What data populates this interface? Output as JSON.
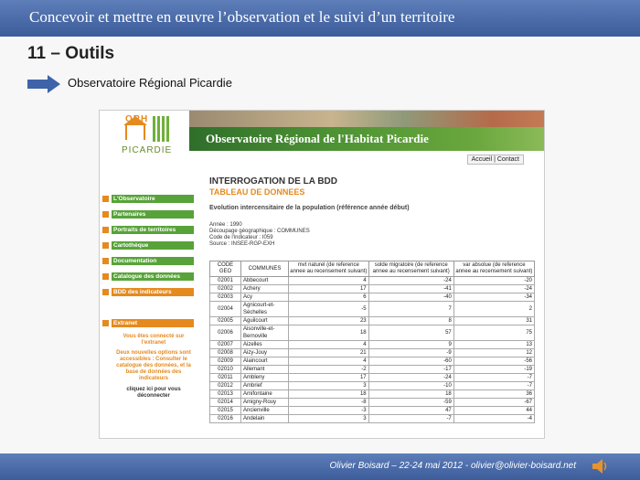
{
  "slide": {
    "title": "Concevoir et mettre en œuvre l’observation et le suivi d’un territoire",
    "heading": "11 – Outils",
    "subtitle": "Observatoire Régional Picardie",
    "footer": "Olivier Boisard – 22-24 mai 2012 - olivier@olivier-boisard.net"
  },
  "site": {
    "logo_top": "ORH",
    "logo_bottom": "PICARDIE",
    "banner": "Observatoire Régional de l'Habitat Picardie",
    "header_link": "Accueil | Contact",
    "nav": [
      {
        "label": "L'Observatoire",
        "color": "green"
      },
      {
        "label": "Partenaires",
        "color": "green"
      },
      {
        "label": "Portraits de territoires",
        "color": "green"
      },
      {
        "label": "Cartothèque",
        "color": "green"
      },
      {
        "label": "Documentation",
        "color": "green"
      },
      {
        "label": "Catalogue des données",
        "color": "green"
      },
      {
        "label": "BDD des indicateurs",
        "color": "orange"
      },
      {
        "label": "Extranet",
        "color": "orange"
      }
    ],
    "extranet_text1": "Vous êtes connecté sur l'extranet",
    "extranet_text2": "Deux nouvelles options sont accessibles : Consulter le catalogue des données, et la base de données des indicateurs",
    "extranet_text3": "cliquez ici pour vous déconnecter"
  },
  "main": {
    "title": "INTERROGATION DE LA BDD",
    "subtitle": "TABLEAU DE DONNEES",
    "section": "Evolution intercensitaire de la population (référence année début)",
    "meta": [
      "Année : 1990",
      "Découpage géographique : COMMUNES",
      "Code de l'indicateur : I059",
      "Source : INSEE-RGP-EXH"
    ],
    "columns": [
      "CODE GEO",
      "COMMUNES",
      "mvt naturel (de reference annee au recensement suivant)",
      "solde migratoire (de reference annee au recensement suivant)",
      "var absolue (de reference annee au recensement suivant)"
    ],
    "rows": [
      [
        "02001",
        "Abbecourt",
        "4",
        "-24",
        "-20"
      ],
      [
        "02002",
        "Achery",
        "17",
        "-41",
        "-24"
      ],
      [
        "02003",
        "Acy",
        "6",
        "-40",
        "-34"
      ],
      [
        "02004",
        "Agnicourt-et-Séchelles",
        "-5",
        "7",
        "2"
      ],
      [
        "02005",
        "Aguilcourt",
        "23",
        "8",
        "31"
      ],
      [
        "02006",
        "Aisonville-et-Bernoville",
        "18",
        "57",
        "75"
      ],
      [
        "02007",
        "Aizelles",
        "4",
        "9",
        "13"
      ],
      [
        "02008",
        "Aizy-Jouy",
        "21",
        "-9",
        "12"
      ],
      [
        "02009",
        "Alaincourt",
        "4",
        "-60",
        "-56"
      ],
      [
        "02010",
        "Allemant",
        "-2",
        "-17",
        "-19"
      ],
      [
        "02011",
        "Ambleny",
        "17",
        "-24",
        "-7"
      ],
      [
        "02012",
        "Ambrief",
        "3",
        "-10",
        "-7"
      ],
      [
        "02013",
        "Amifontaine",
        "18",
        "18",
        "36"
      ],
      [
        "02014",
        "Amigny-Rouy",
        "-8",
        "-59",
        "-67"
      ],
      [
        "02015",
        "Ancienville",
        "-3",
        "47",
        "44"
      ],
      [
        "02016",
        "Andelain",
        "3",
        "-7",
        "-4"
      ]
    ]
  }
}
